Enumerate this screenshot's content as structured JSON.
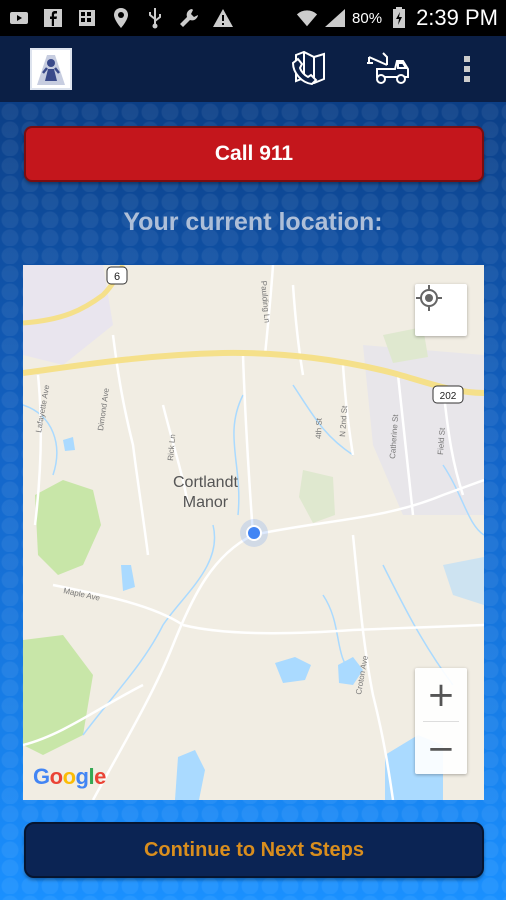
{
  "status_bar": {
    "battery_percent": "80%",
    "time": "2:39 PM",
    "icons": [
      "facebook-icon",
      "calculator-icon",
      "location-pin-icon",
      "usb-icon",
      "wrench-icon",
      "warning-icon",
      "wifi-icon",
      "signal-icon",
      "battery-icon"
    ]
  },
  "app_bar": {
    "icons": [
      "app-logo-icon",
      "phone-map-icon",
      "tow-truck-icon",
      "overflow-menu-icon"
    ]
  },
  "actions": {
    "call_label": "Call 911",
    "continue_label": "Continue to Next Steps"
  },
  "location": {
    "title": "Your current location:"
  },
  "map": {
    "place_label_line1": "Cortlandt",
    "place_label_line2": "Manor",
    "roads": [
      "Lafayette Ave",
      "Dimond Ave",
      "Rick Ln",
      "Maple Ave",
      "Paulding Ln",
      "4th St",
      "N 2nd St",
      "Catherine St",
      "Field St",
      "Croton Ave"
    ],
    "route_badges": [
      "6",
      "202"
    ],
    "zoom_in": "+",
    "zoom_out": "−",
    "attribution": [
      "G",
      "o",
      "o",
      "g",
      "l",
      "e"
    ],
    "colors": {
      "land": "#f1ede3",
      "water": "#aadaff",
      "park": "#c8e6a8",
      "highway": "#f5e08a"
    }
  }
}
